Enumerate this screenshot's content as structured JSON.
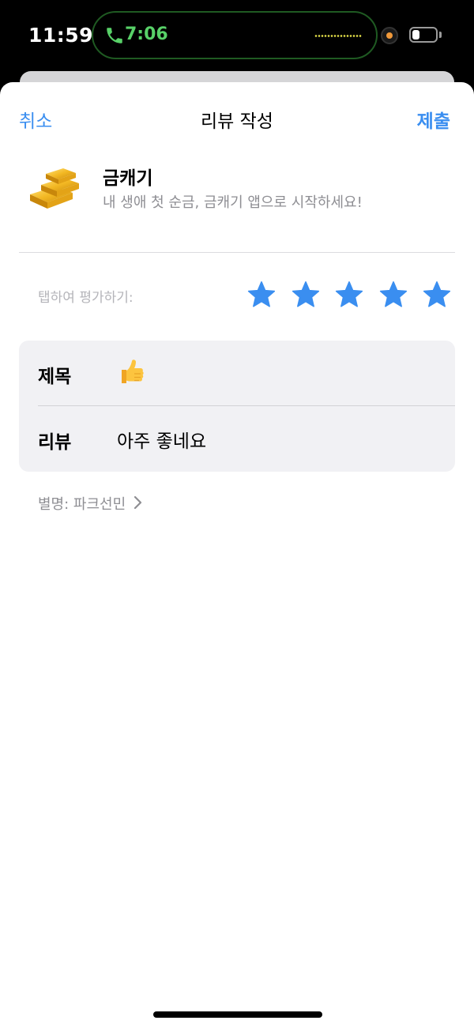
{
  "status_bar": {
    "time": "11:59",
    "call_time": "7:06",
    "icons": [
      "phone-icon",
      "waveform-icon",
      "camera-indicator-icon",
      "battery-icon"
    ]
  },
  "nav": {
    "cancel_label": "취소",
    "title": "리뷰 작성",
    "submit_label": "제출"
  },
  "app": {
    "name": "금캐기",
    "subtitle": "내 생애 첫 순금, 금캐기 앱으로 시작하세요!",
    "icon": "gold-bars-icon"
  },
  "rating": {
    "prompt": "탭하여 평가하기:",
    "value": 5,
    "max": 5,
    "star_color": "#3a8ef0"
  },
  "form": {
    "title_label": "제목",
    "title_value_icon": "thumbs-up-emoji",
    "review_label": "리뷰",
    "review_value": "아주 좋네요"
  },
  "nickname": {
    "text": "별명: 파크선민"
  },
  "colors": {
    "accent": "#3a8ef0",
    "call_green": "#58d168",
    "secondary_text": "#8e8e93",
    "card_bg": "#f1f1f4"
  }
}
